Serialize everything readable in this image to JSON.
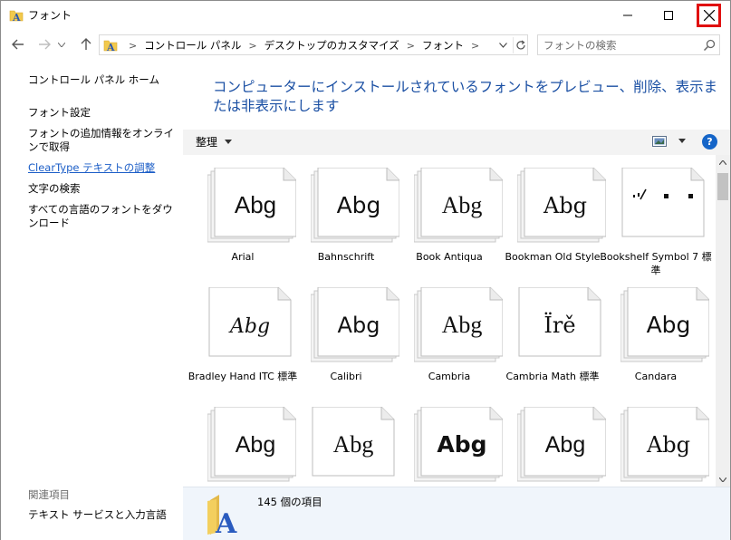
{
  "window": {
    "title": "フォント",
    "colors": {
      "accent": "#1a4fa3",
      "link": "#1c5ec7",
      "close_highlight": "#e01010"
    }
  },
  "address": {
    "crumbs": [
      "コントロール パネル",
      "デスクトップのカスタマイズ",
      "フォント"
    ],
    "search_placeholder": "フォントの検索"
  },
  "left_pane": {
    "home": "コントロール パネル ホーム",
    "settings": "フォント設定",
    "online": "フォントの追加情報をオンラインで取得",
    "cleartype": "ClearType テキストの調整",
    "char_search": "文字の検索",
    "download": "すべての言語のフォントをダウンロード",
    "related": "関連項目",
    "text_services": "テキスト サービスと入力言語"
  },
  "main": {
    "heading": "コンピューターにインストールされているフォントをプレビュー、削除、表示または非表示にします",
    "organize": "整理",
    "help": "?",
    "fonts": [
      {
        "label": "Arial",
        "sample": "Abg",
        "stack": true
      },
      {
        "label": "Bahnschrift",
        "sample": "Abg",
        "stack": true
      },
      {
        "label": "Book Antiqua",
        "sample": "Abg",
        "stack": true
      },
      {
        "label": "Bookman Old Style",
        "sample": "Abg",
        "stack": true
      },
      {
        "label": "Bookshelf Symbol 7 標準",
        "sample": "",
        "stack": false
      },
      {
        "label": "Bradley Hand ITC 標準",
        "sample": "Abg",
        "stack": false
      },
      {
        "label": "Calibri",
        "sample": "Abg",
        "stack": true
      },
      {
        "label": "Cambria",
        "sample": "Abg",
        "stack": true
      },
      {
        "label": "Cambria Math 標準",
        "sample": "Ïrě",
        "stack": false
      },
      {
        "label": "Candara",
        "sample": "Abg",
        "stack": true
      },
      {
        "label": "",
        "sample": "Abg",
        "stack": true
      },
      {
        "label": "",
        "sample": "Abg",
        "stack": false
      },
      {
        "label": "",
        "sample": "Abg",
        "stack": true
      },
      {
        "label": "",
        "sample": "Abg",
        "stack": true
      },
      {
        "label": "",
        "sample": "Abg",
        "stack": true
      }
    ]
  },
  "details": {
    "count": "145 個の項目"
  }
}
